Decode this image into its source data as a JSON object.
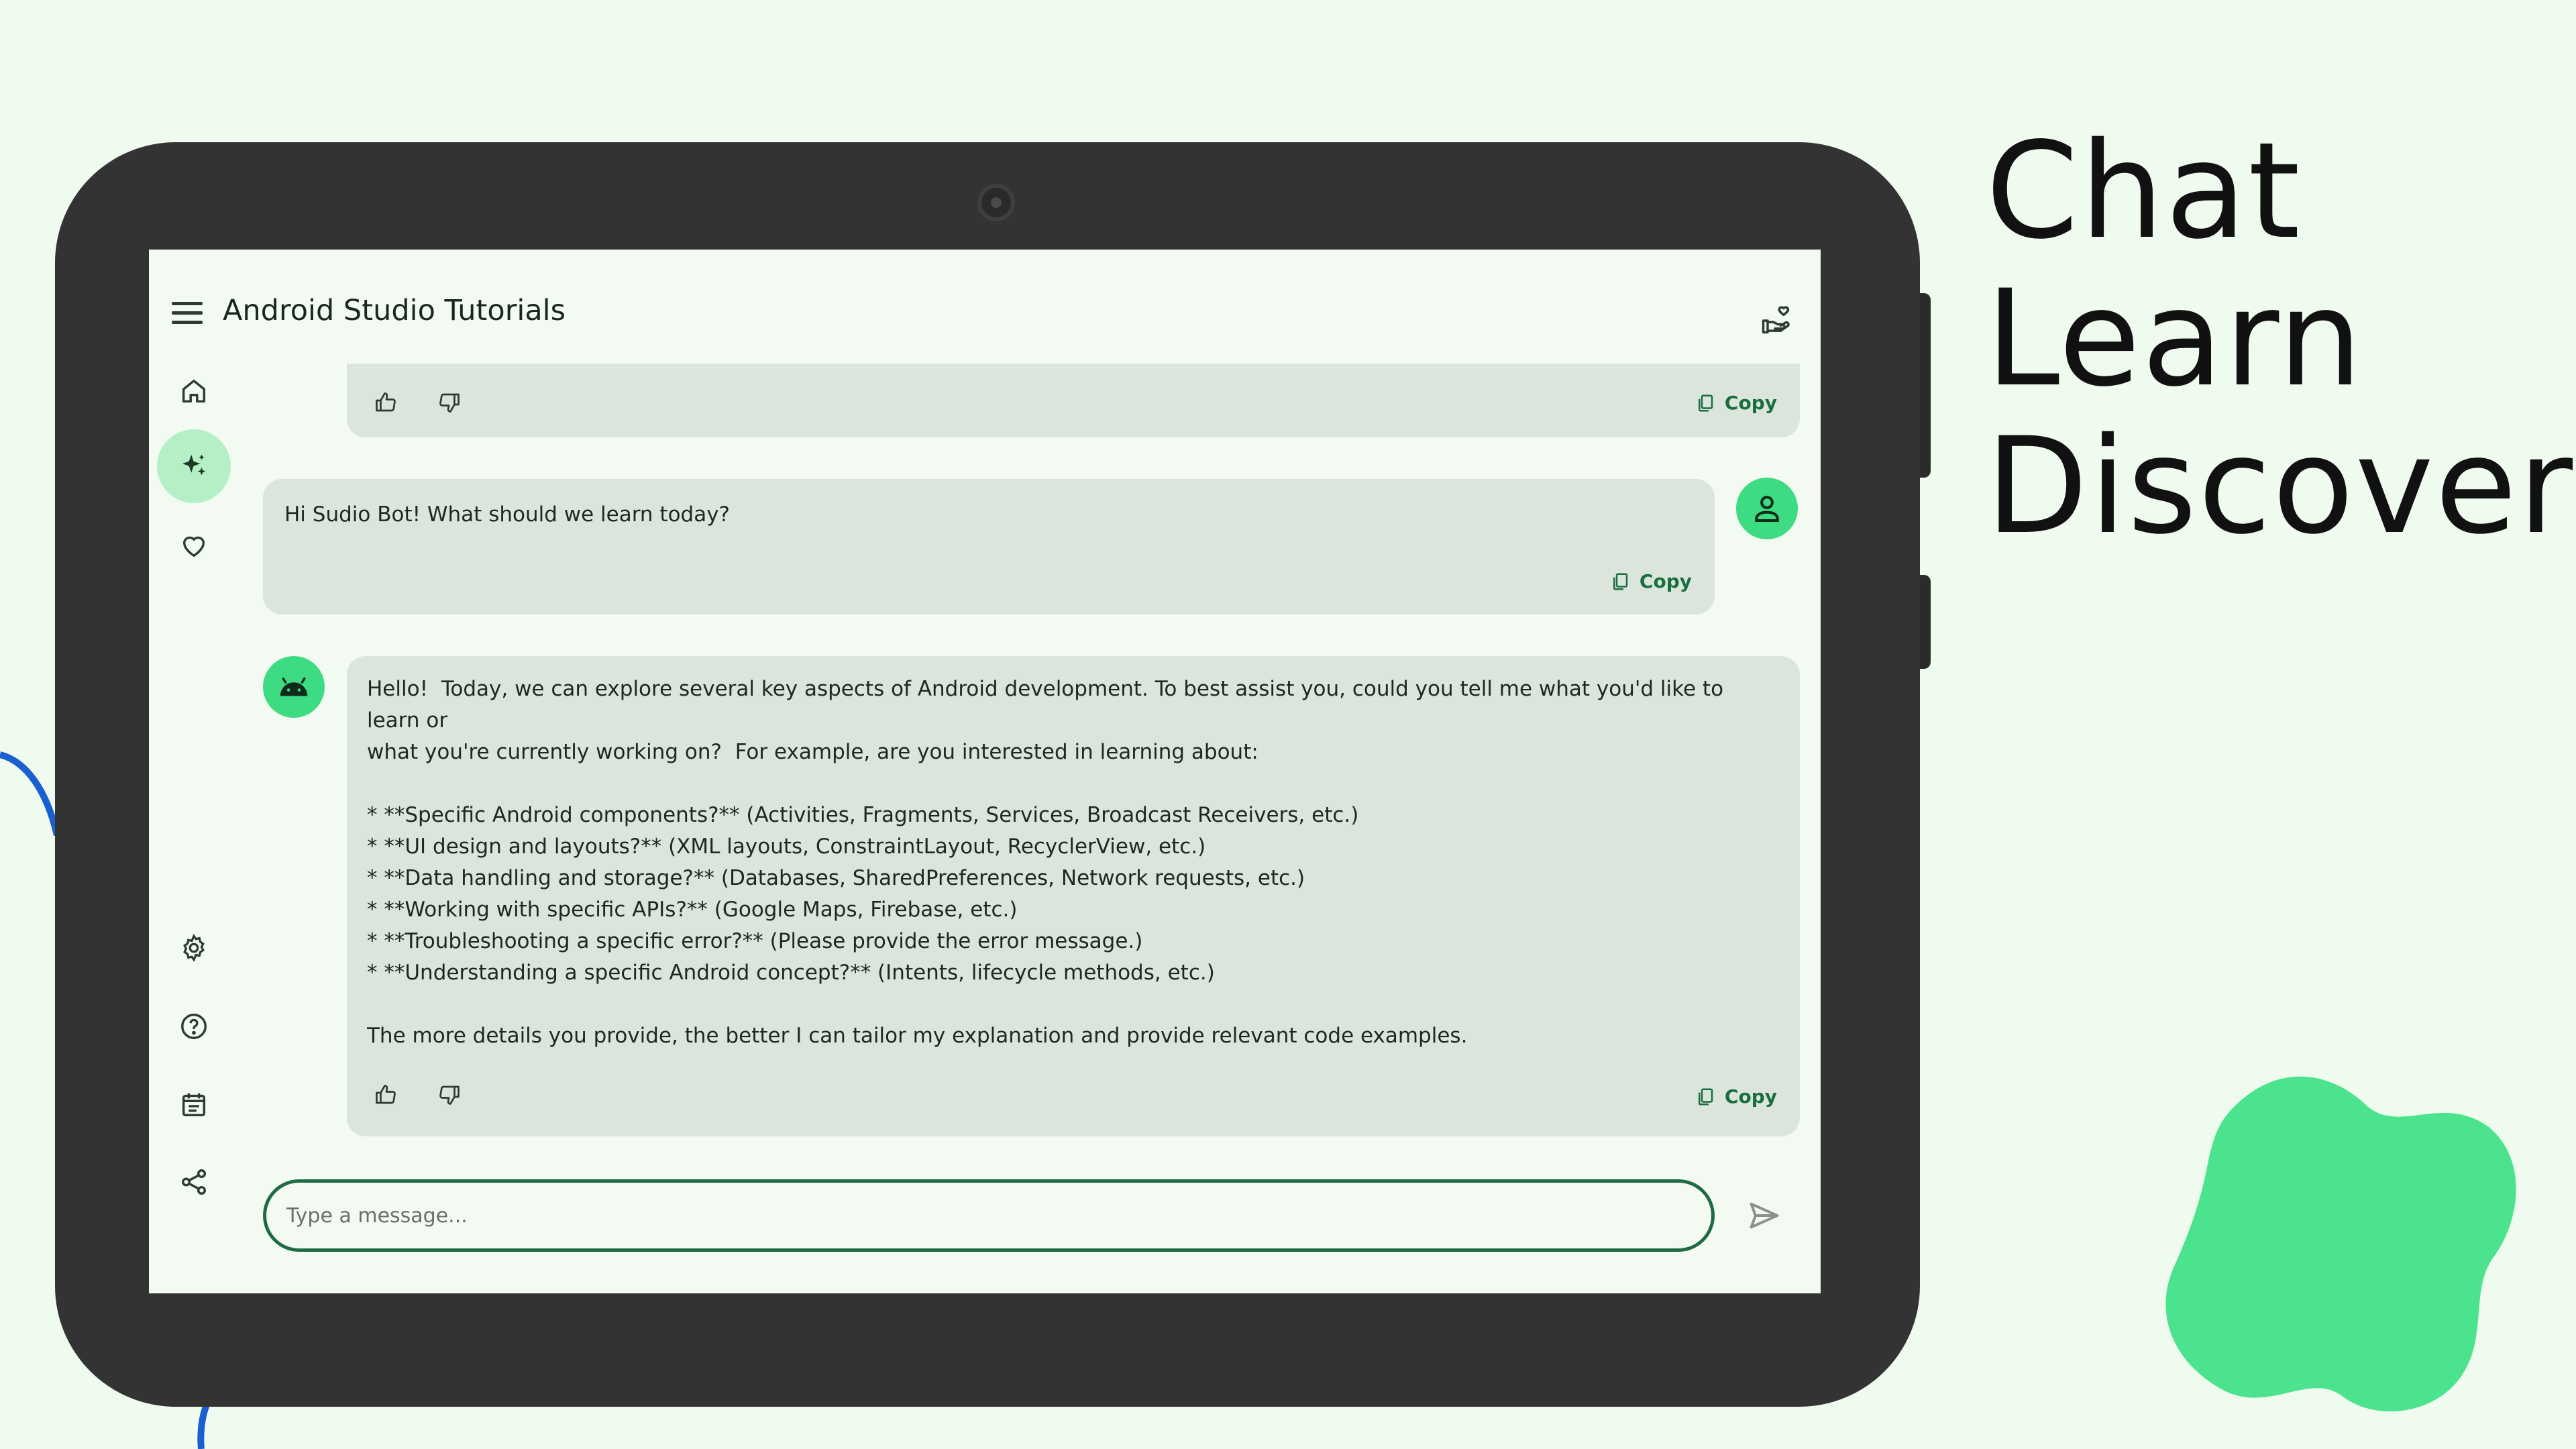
{
  "tagline": {
    "line1": "Chat",
    "line2": "Learn",
    "line3": "Discover"
  },
  "colors": {
    "accent": "#3ddb82",
    "primary": "#1e6a42",
    "card": "#dbe5dc",
    "background": "#f0fbef",
    "device": "#333333"
  },
  "app": {
    "title": "Android Studio Tutorials",
    "menu_icon": "menu-icon",
    "action_icon": "donate-icon"
  },
  "nav_rail": {
    "top_items": [
      {
        "icon": "home-icon",
        "active": false
      },
      {
        "icon": "sparkle-icon",
        "active": true
      },
      {
        "icon": "heart-icon",
        "active": false
      }
    ],
    "bottom_items": [
      {
        "icon": "settings-icon"
      },
      {
        "icon": "help-icon"
      },
      {
        "icon": "calendar-icon"
      },
      {
        "icon": "share-icon"
      }
    ]
  },
  "messages": [
    {
      "role": "bot",
      "text": "",
      "copy_label": "Copy"
    },
    {
      "role": "user",
      "text": "Hi Sudio Bot! What should we learn today?",
      "copy_label": "Copy",
      "avatar_icon": "person-icon"
    },
    {
      "role": "bot",
      "avatar_icon": "android-icon",
      "text": "Hello!  Today, we can explore several key aspects of Android development. To best assist you, could you tell me what you'd like to learn or\nwhat you're currently working on?  For example, are you interested in learning about:\n\n* **Specific Android components?** (Activities, Fragments, Services, Broadcast Receivers, etc.)\n* **UI design and layouts?** (XML layouts, ConstraintLayout, RecyclerView, etc.)\n* **Data handling and storage?** (Databases, SharedPreferences, Network requests, etc.)\n* **Working with specific APIs?** (Google Maps, Firebase, etc.)\n* **Troubleshooting a specific error?** (Please provide the error message.)\n* **Understanding a specific Android concept?** (Intents, lifecycle methods, etc.)\n\nThe more details you provide, the better I can tailor my explanation and provide relevant code examples.",
      "copy_label": "Copy"
    }
  ],
  "composer": {
    "placeholder": "Type a message...",
    "value": "",
    "send_icon": "send-icon"
  }
}
